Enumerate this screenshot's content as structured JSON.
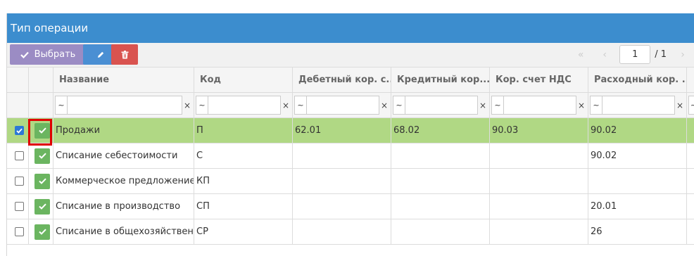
{
  "window": {
    "title": "Тип операции"
  },
  "toolbar": {
    "select_label": "Выбрать"
  },
  "pager": {
    "prev2": "«",
    "prev": "‹",
    "page": "1",
    "total": "/ 1",
    "next": "›"
  },
  "colors": {
    "titlebar": "#3c8dce",
    "selected_row": "#b0d884",
    "select_btn": "#9b8cc4",
    "edit_btn": "#4a8fd3",
    "delete_btn": "#d9534f",
    "ok_icon": "#6bb560",
    "highlight": "#e00000"
  },
  "columns": [
    "Название",
    "Код",
    "Дебетный кор. с...",
    "Кредитный кор....",
    "Кор. счет НДС",
    "Расходный кор. ..."
  ],
  "filter": {
    "operator": "~",
    "clear": "×"
  },
  "rows": [
    {
      "selected": true,
      "name": "Продажи",
      "code": "П",
      "debit": "62.01",
      "credit": "68.02",
      "vat": "90.03",
      "expense": "90.02"
    },
    {
      "selected": false,
      "name": "Списание себестоимости",
      "code": "С",
      "debit": "",
      "credit": "",
      "vat": "",
      "expense": "90.02"
    },
    {
      "selected": false,
      "name": "Коммерческое предложение",
      "code": "КП",
      "debit": "",
      "credit": "",
      "vat": "",
      "expense": ""
    },
    {
      "selected": false,
      "name": "Списание в производство",
      "code": "СП",
      "debit": "",
      "credit": "",
      "vat": "",
      "expense": "20.01"
    },
    {
      "selected": false,
      "name": "Списание в общехозяйствен...",
      "code": "СР",
      "debit": "",
      "credit": "",
      "vat": "",
      "expense": "26"
    }
  ]
}
